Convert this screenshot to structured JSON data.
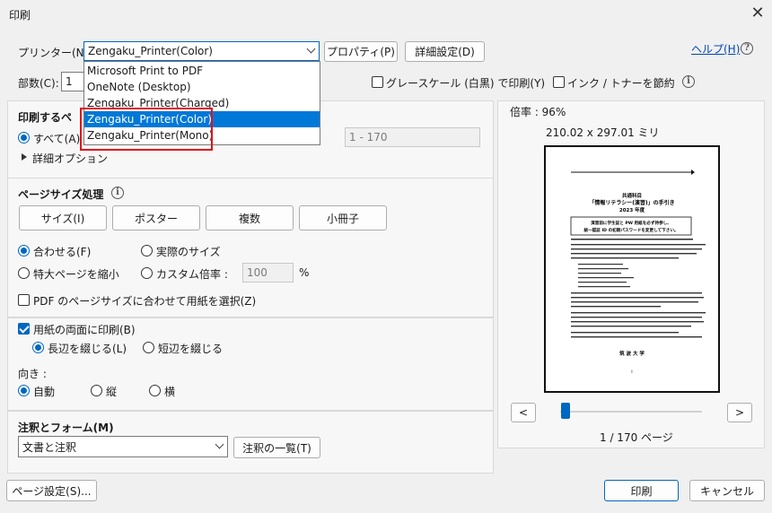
{
  "window": {
    "title": "印刷"
  },
  "printer": {
    "label": "プリンター(N):",
    "selected": "Zengaku_Printer(Color)",
    "options": [
      "Microsoft Print to PDF",
      "OneNote (Desktop)",
      "Zengaku_Printer(Charged)",
      "Zengaku_Printer(Color)",
      "Zengaku_Printer(Mono)"
    ],
    "properties_button": "プロパティ(P)",
    "advanced_button": "詳細設定(D)",
    "help_link": "ヘルプ(H)"
  },
  "copies": {
    "label": "部数(C):",
    "value": "1"
  },
  "options_row": {
    "grayscale": "グレースケール (白黒) で印刷(Y)",
    "save_ink": "インク / トナーを節約"
  },
  "pages_section": {
    "title": "印刷するペ",
    "all": "すべて(A)",
    "range_value": "1 - 170",
    "more_options": "詳細オプション"
  },
  "size_section": {
    "title": "ページサイズ処理",
    "buttons": [
      "サイズ(I)",
      "ポスター",
      "複数",
      "小冊子"
    ],
    "fit": "合わせる(F)",
    "actual": "実際のサイズ",
    "shrink": "特大ページを縮小",
    "custom": "カスタム倍率 :",
    "custom_value": "100",
    "percent": "%",
    "pdf_paper": "PDF のページサイズに合わせて用紙を選択(Z)"
  },
  "duplex": {
    "label": "用紙の両面に印刷(B)",
    "long_edge": "長辺を綴じる(L)",
    "short_edge": "短辺を綴じる"
  },
  "orientation": {
    "label": "向き :",
    "auto": "自動",
    "portrait": "縦",
    "landscape": "横"
  },
  "annotations": {
    "title": "注釈とフォーム(M)",
    "selected": "文書と注釈",
    "summary_button": "注釈の一覧(T)"
  },
  "preview": {
    "zoom": "倍率 : 96%",
    "dimensions": "210.02 x 297.01 ミリ",
    "page_indicator": "1 / 170 ページ",
    "prev": "<",
    "next": ">",
    "slider_position": 0.0,
    "doc": {
      "title1": "共通科目",
      "title2": "「情報リテラシー(演習)」の手引き",
      "title3": "2023 年度",
      "box1": "演習前に学生証と PW 用紙を必ず持参し、",
      "box2": "統一認証 ID の初期パスワードを変更して下さい。",
      "footer": "筑 波 大 学",
      "pagenum": "i"
    }
  },
  "footer": {
    "page_setup": "ページ設定(S)...",
    "print": "印刷",
    "cancel": "キャンセル"
  }
}
